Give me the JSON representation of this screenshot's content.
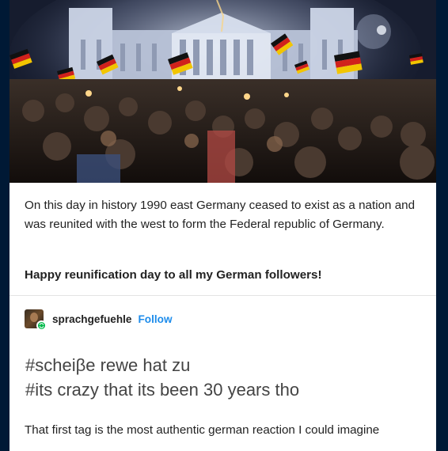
{
  "post": {
    "photo_icon": "crowd-at-reichstag-photo",
    "body_text": "On this day in history 1990 east Germany ceased to exist as a nation and was reunited with the west to form the Federal republic of Germany.",
    "bold_line": "Happy reunification day to all my German followers!"
  },
  "reblog": {
    "username": "sprachgefuehle",
    "follow_label": "Follow",
    "tags": [
      "#scheiβe rewe hat zu",
      "#its crazy that its been 30 years tho"
    ],
    "comment": "That first tag is the most authentic german reaction I could imagine"
  },
  "colors": {
    "background": "#001935",
    "follow": "#1d8ceb",
    "badge": "#00b94a"
  }
}
